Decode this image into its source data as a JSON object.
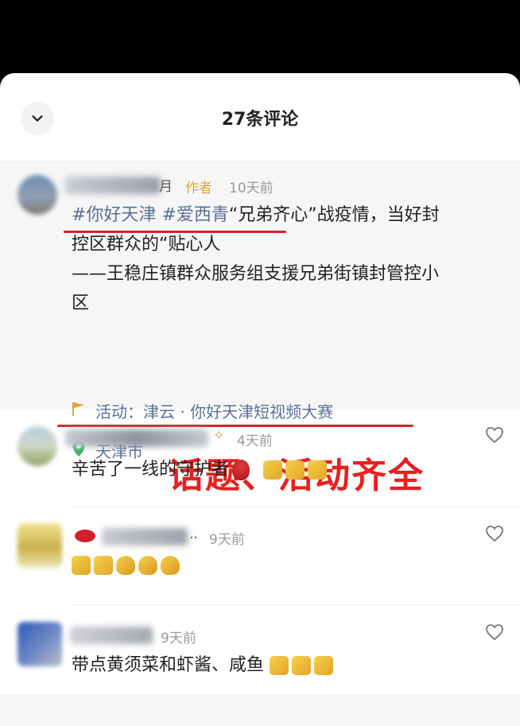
{
  "header": {
    "title": "27条评论",
    "collapse_icon": "chevron-down-icon"
  },
  "author_comment": {
    "name_tail": "月",
    "author_tag": "作者",
    "time": "10天前",
    "hashtag1": "#你好天津",
    "hashtag2": "#爱西青",
    "line1_rest": "“兄弟齐心”战疫情，当好封",
    "line2": "控区群众的“贴心人",
    "line3": "——王稳庄镇群众服务组支援兄弟街镇封管控小",
    "line4": "区",
    "activity": "活动：津云 · 你好天津短视频大赛",
    "location": "天津市",
    "overlay": "话题、活动齐全",
    "colors": {
      "link": "#5a6f96",
      "author_tag": "#e0a43a",
      "overlay": "#e8201f"
    }
  },
  "comments": [
    {
      "time": "4天前",
      "text": "辛苦了一线的守护者"
    },
    {
      "time": "9天前",
      "name_suffix": "..",
      "text": ""
    },
    {
      "time": "9天前",
      "text": "带点黄须菜和虾酱、咸鱼"
    }
  ]
}
